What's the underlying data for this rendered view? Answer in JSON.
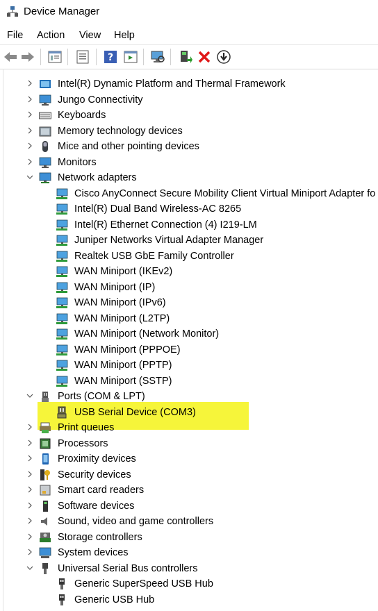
{
  "window": {
    "title": "Device Manager"
  },
  "menu": [
    "File",
    "Action",
    "View",
    "Help"
  ],
  "toolbar": [
    "back-icon",
    "forward-icon",
    "properties-icon",
    "update-driver-icon",
    "help-icon",
    "view-icon",
    "scan-hardware-icon",
    "enable-device-icon",
    "uninstall-icon",
    "download-icon"
  ],
  "tree": {
    "categories": [
      {
        "label": "Intel(R) Dynamic Platform and Thermal Framework",
        "icon": "thermal-icon",
        "expanded": false
      },
      {
        "label": "Jungo Connectivity",
        "icon": "network-monitor-icon",
        "expanded": false
      },
      {
        "label": "Keyboards",
        "icon": "keyboard-icon",
        "expanded": false
      },
      {
        "label": "Memory technology devices",
        "icon": "memory-icon",
        "expanded": false
      },
      {
        "label": "Mice and other pointing devices",
        "icon": "mouse-icon",
        "expanded": false
      },
      {
        "label": "Monitors",
        "icon": "monitor-icon",
        "expanded": false
      },
      {
        "label": "Network adapters",
        "icon": "network-icon",
        "expanded": true
      },
      {
        "label": "Ports (COM & LPT)",
        "icon": "port-icon",
        "expanded": true
      },
      {
        "label": "Print queues",
        "icon": "printer-icon",
        "expanded": false
      },
      {
        "label": "Processors",
        "icon": "processor-icon",
        "expanded": false
      },
      {
        "label": "Proximity devices",
        "icon": "proximity-icon",
        "expanded": false
      },
      {
        "label": "Security devices",
        "icon": "security-icon",
        "expanded": false
      },
      {
        "label": "Smart card readers",
        "icon": "smart-card-icon",
        "expanded": false
      },
      {
        "label": "Software devices",
        "icon": "software-icon",
        "expanded": false
      },
      {
        "label": "Sound, video and game controllers",
        "icon": "speaker-icon",
        "expanded": false
      },
      {
        "label": "Storage controllers",
        "icon": "storage-icon",
        "expanded": false
      },
      {
        "label": "System devices",
        "icon": "system-icon",
        "expanded": false
      },
      {
        "label": "Universal Serial Bus controllers",
        "icon": "usb-icon",
        "expanded": true
      }
    ],
    "network_adapters": [
      "Cisco AnyConnect Secure Mobility Client Virtual Miniport Adapter fo",
      "Intel(R) Dual Band Wireless-AC 8265",
      "Intel(R) Ethernet Connection (4) I219-LM",
      "Juniper Networks Virtual Adapter Manager",
      "Realtek USB GbE Family Controller",
      "WAN Miniport (IKEv2)",
      "WAN Miniport (IP)",
      "WAN Miniport (IPv6)",
      "WAN Miniport (L2TP)",
      "WAN Miniport (Network Monitor)",
      "WAN Miniport (PPPOE)",
      "WAN Miniport (PPTP)",
      "WAN Miniport (SSTP)"
    ],
    "ports": [
      "USB Serial Device (COM3)"
    ],
    "usb": [
      "Generic SuperSpeed USB Hub",
      "Generic USB Hub"
    ]
  },
  "highlight_color": "#f6f53a"
}
